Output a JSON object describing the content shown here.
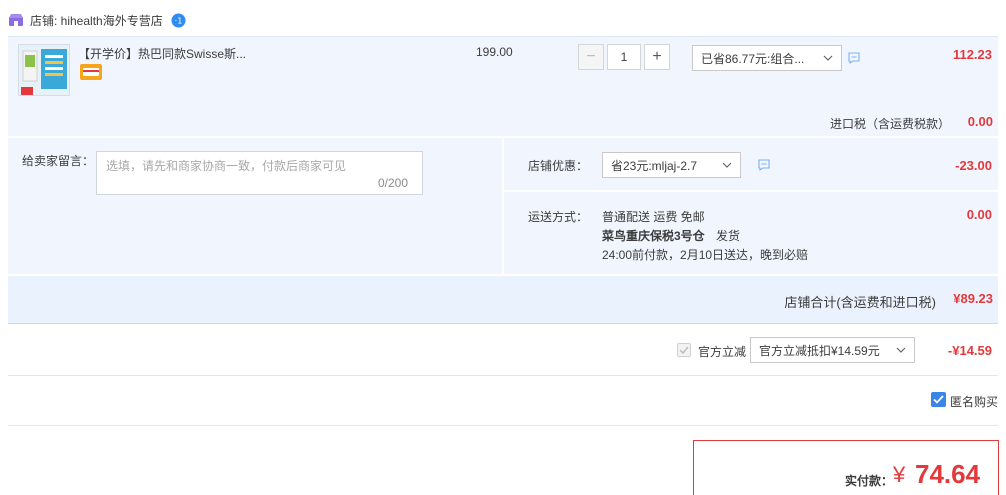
{
  "shop": {
    "label": "店铺: hihealth海外专营店",
    "icon": "store-icon",
    "badge_icon": "info-badge-icon"
  },
  "item": {
    "title": "【开学价】热巴同款Swisse斯...",
    "price": "199.00",
    "quantity": "1",
    "minus_label": "−",
    "plus_label": "+",
    "promo_select": "已省86.77元:组合...",
    "amount": "112.23",
    "tax_label": "进口税（含运费税款）",
    "tax_amount": "0.00"
  },
  "message": {
    "label": "给卖家留言：",
    "placeholder": "选填，请先和商家协商一致，付款后商家可见",
    "counter": "0/200"
  },
  "coupon": {
    "label": "店铺优惠：",
    "select": "省23元:mljaj-2.7",
    "amount": "-23.00"
  },
  "shipping": {
    "label": "运送方式：",
    "line1": "普通配送 运费 免邮",
    "line2_bold": "菜鸟重庆保税3号仓",
    "line2_rest": "发货",
    "line3": "24:00前付款，2月10日送达，晚到必赔",
    "amount": "0.00"
  },
  "shop_total": {
    "label": "店铺合计(含运费和进口税)",
    "amount": "¥89.23"
  },
  "official": {
    "label": "官方立减",
    "select": "官方立减抵扣¥14.59元",
    "amount": "-¥14.59"
  },
  "anonymous": {
    "label": "匿名购买",
    "checked": true
  },
  "pay": {
    "label": "实付款：",
    "currency": "¥",
    "amount": "74.64"
  },
  "colors": {
    "accent_red": "#e4393c",
    "panel_blue": "#f1f6fe",
    "checkbox_blue": "#3a86e8"
  }
}
